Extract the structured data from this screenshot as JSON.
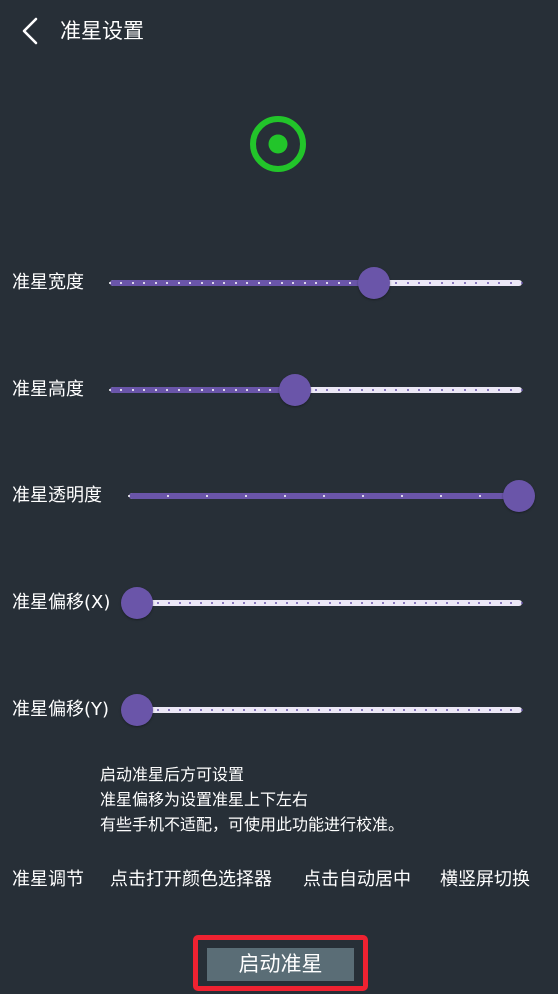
{
  "header": {
    "title": "准星设置",
    "back_icon": "chevron-left-icon"
  },
  "crosshair": {
    "icon": "crosshair-target-icon",
    "color": "#22c52a"
  },
  "sliders": [
    {
      "label": "准星宽度",
      "value": 0.64
    },
    {
      "label": "准星高度",
      "value": 0.45
    },
    {
      "label": "准星透明度",
      "value": 1.0
    },
    {
      "label": "准星偏移(X)",
      "value": 0.0
    },
    {
      "label": "准星偏移(Y)",
      "value": 0.0
    }
  ],
  "info": [
    "启动准星后方可设置",
    "准星偏移为设置准星上下左右",
    "有些手机不适配，可使用此功能进行校准。"
  ],
  "actions": [
    "准星调节",
    "点击打开颜色选择器",
    "点击自动居中",
    "横竖屏切换"
  ],
  "start_button": "启动准星",
  "colors": {
    "background": "#272f37",
    "slider_accent": "#6a55a9",
    "slider_track": "#ece8f6",
    "highlight_border": "#ef2231",
    "button_bg": "#5a6d76"
  }
}
